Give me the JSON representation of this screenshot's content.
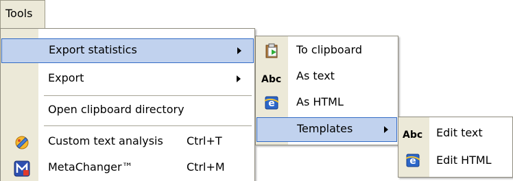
{
  "menubar": {
    "tools_label": "Tools"
  },
  "tools_menu": {
    "items": [
      {
        "label": "Export statistics"
      },
      {
        "label": "Export"
      },
      {
        "label": "Open clipboard directory"
      },
      {
        "label": "Custom text analysis",
        "shortcut": "Ctrl+T",
        "icon": "analysis-icon"
      },
      {
        "label": "MetaChanger™",
        "shortcut": "Ctrl+M",
        "icon": "metachanger-icon"
      }
    ]
  },
  "export_statistics_menu": {
    "items": [
      {
        "label": "To clipboard",
        "icon": "clipboard-icon"
      },
      {
        "label": "As text",
        "icon_text": "Abc"
      },
      {
        "label": "As HTML",
        "icon": "html-icon"
      },
      {
        "label": "Templates"
      }
    ]
  },
  "templates_menu": {
    "items": [
      {
        "label": "Edit text",
        "icon_text": "Abc"
      },
      {
        "label": "Edit HTML",
        "icon": "html-icon"
      }
    ]
  },
  "colors": {
    "highlight_fill": "#c1d2ee",
    "highlight_border": "#316ac5",
    "gutter": "#ece9d8"
  }
}
